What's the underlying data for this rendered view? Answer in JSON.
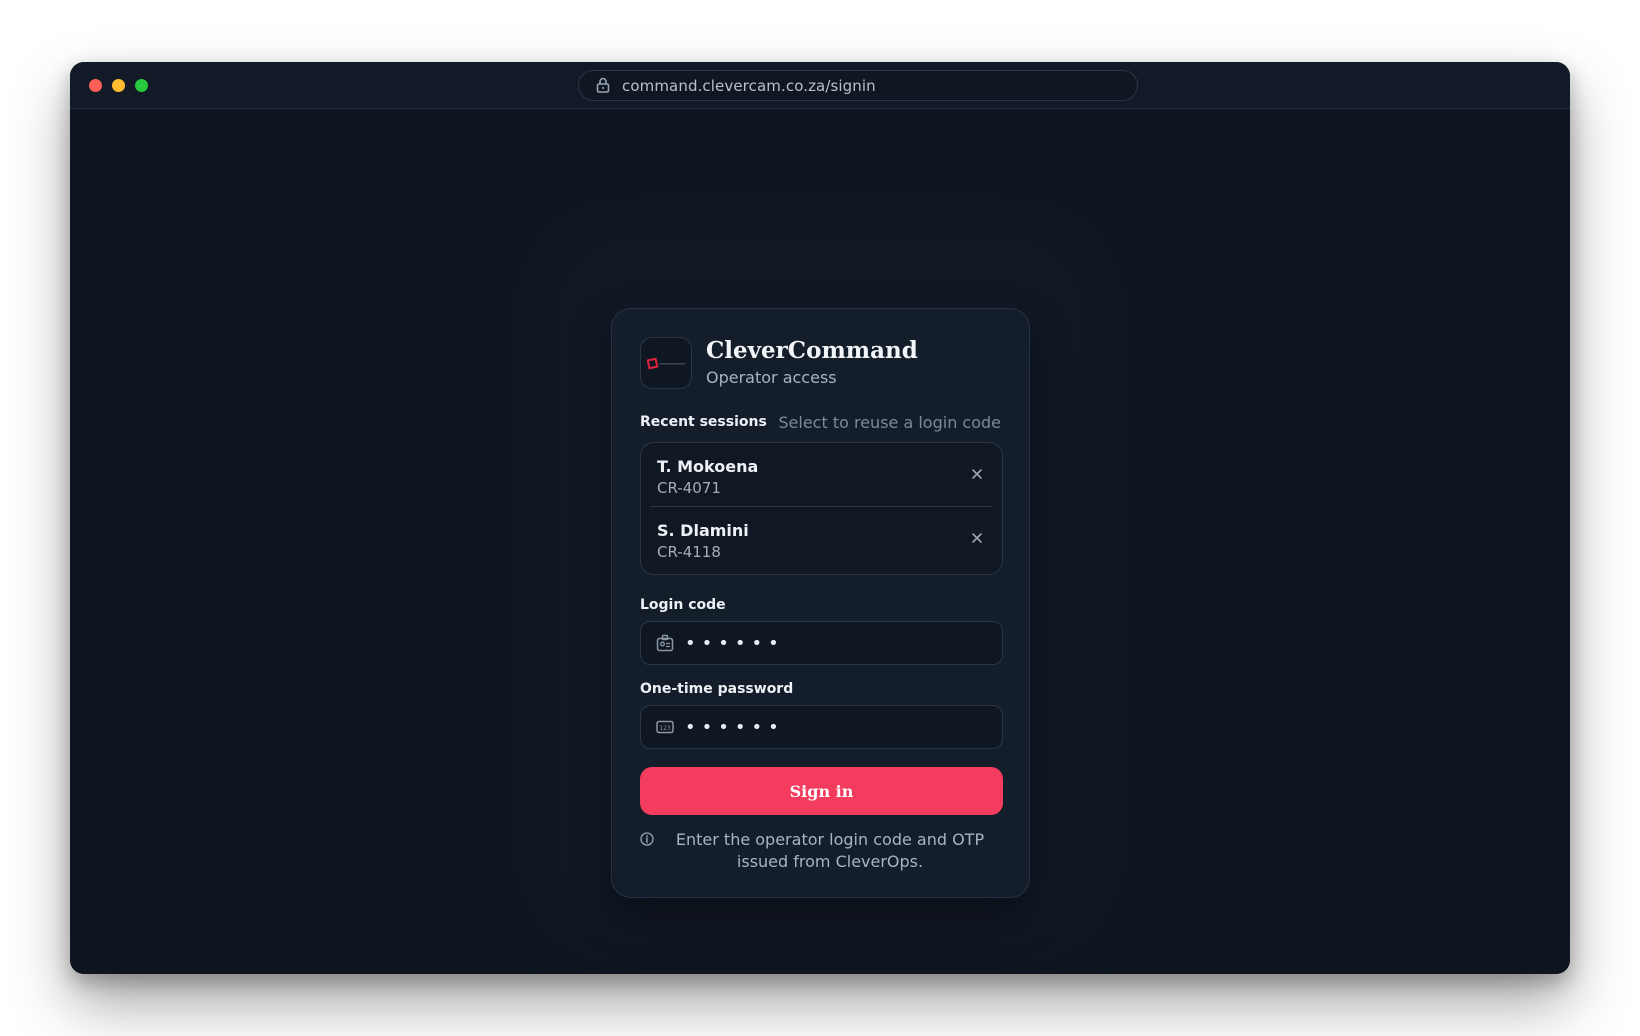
{
  "browser": {
    "url": "command.clevercam.co.za/signin"
  },
  "brand": {
    "name": "CleverCommand",
    "subtitle": "Operator access"
  },
  "recent": {
    "label": "Recent sessions",
    "hint": "Select to reuse a login code",
    "sessions": [
      {
        "name": "T. Mokoena",
        "code": "CR-4071"
      },
      {
        "name": "S. Dlamini",
        "code": "CR-4118"
      }
    ]
  },
  "login": {
    "label": "Login code",
    "value": "••••••"
  },
  "otp": {
    "label": "One-time password",
    "value": "••••••"
  },
  "actions": {
    "signin_label": "Sign in"
  },
  "info": {
    "text": "Enter the operator login code and OTP issued from CleverOps."
  },
  "colors": {
    "accent": "#f33c5e",
    "background": "#0e1520",
    "card": "#141d2a",
    "traffic_red": "#ff5f57",
    "traffic_yellow": "#febc2e",
    "traffic_green": "#28c840"
  }
}
